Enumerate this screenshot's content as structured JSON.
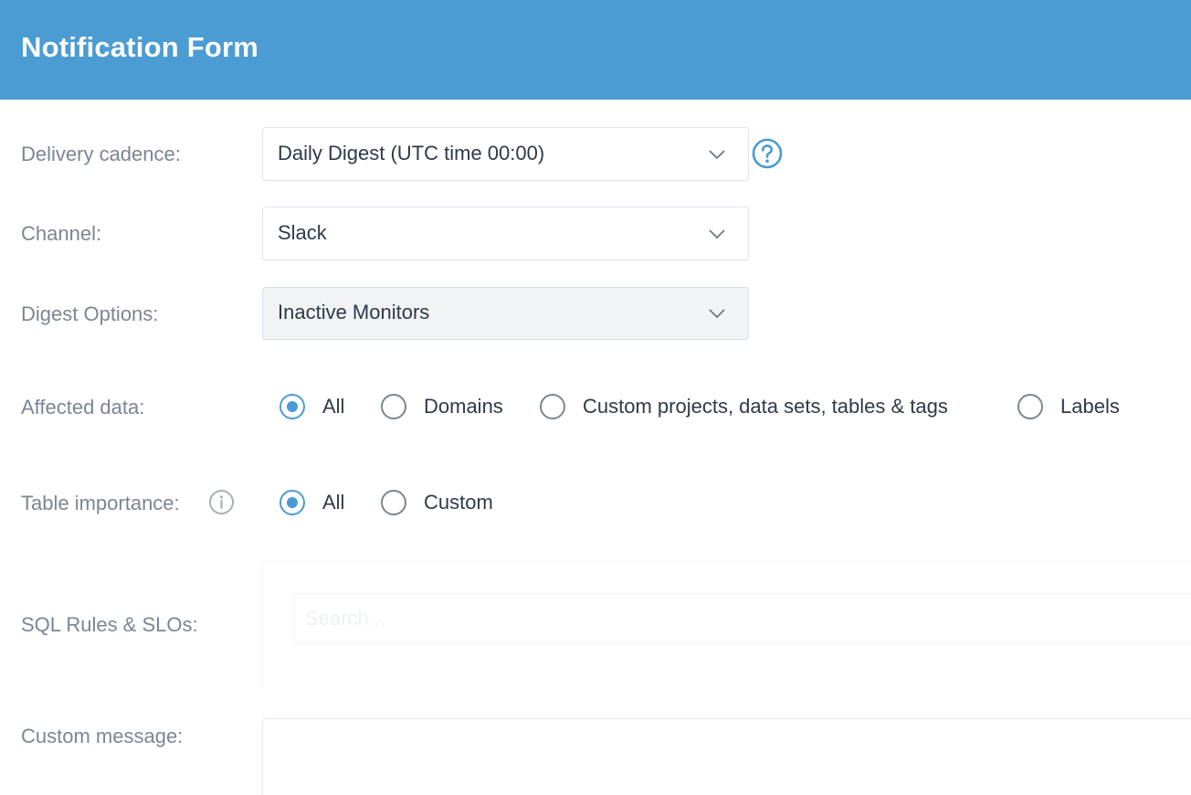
{
  "header": {
    "title": "Notification Form"
  },
  "form": {
    "delivery_cadence": {
      "label": "Delivery cadence:",
      "value": "Daily Digest (UTC time 00:00)"
    },
    "channel": {
      "label": "Channel:",
      "value": "Slack"
    },
    "digest_options": {
      "label": "Digest Options:",
      "value": "Inactive Monitors"
    },
    "affected_data": {
      "label": "Affected data:",
      "options": [
        "All",
        "Domains",
        "Custom projects, data sets, tables & tags",
        "Labels"
      ],
      "selected": "All"
    },
    "table_importance": {
      "label": "Table importance:",
      "options": [
        "All",
        "Custom"
      ],
      "selected": "All"
    },
    "sql_rules": {
      "label": "SQL Rules & SLOs:",
      "placeholder": "Search..."
    },
    "custom_message": {
      "label": "Custom message:",
      "value": ""
    }
  },
  "icons": {
    "help": "help-circle-icon",
    "info": "info-circle-icon",
    "chevron": "chevron-down-icon"
  },
  "colors": {
    "header_bg": "#4b9cd3",
    "accent": "#4b9cd3",
    "label_text": "#7a8694",
    "value_text": "#2d3a4a"
  }
}
